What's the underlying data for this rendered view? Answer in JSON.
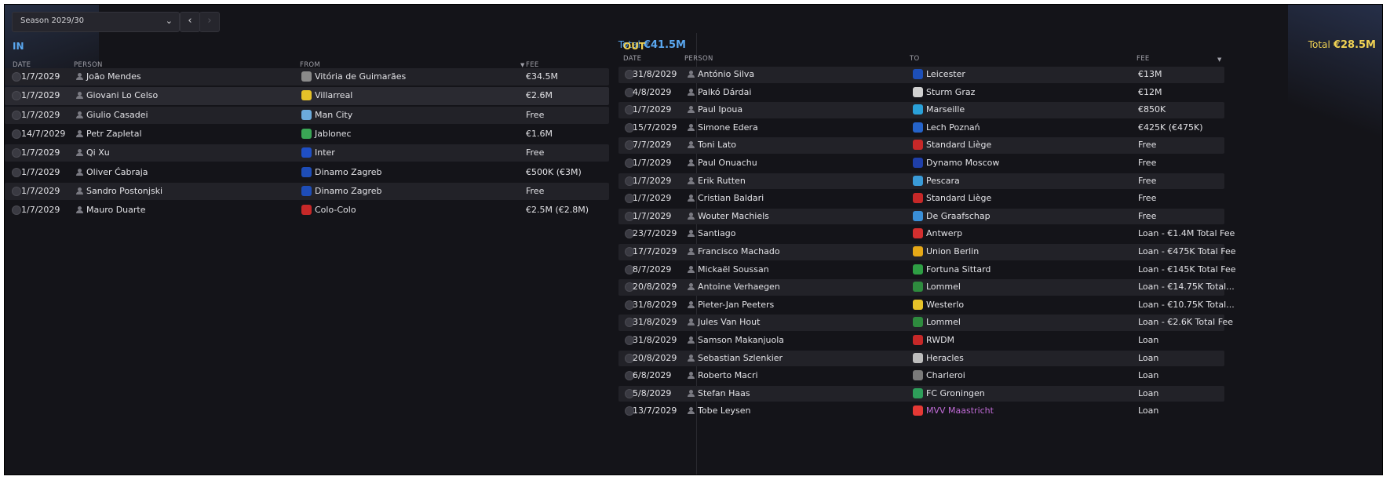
{
  "season": {
    "label": "Season 2029/30"
  },
  "in": {
    "title": "IN",
    "total_label": "Total",
    "total_value": "€41.5M",
    "columns": [
      "DATE",
      "PERSON",
      "FROM",
      "FEE"
    ],
    "rows": [
      {
        "date": "1/7/2029",
        "person": "João Mendes",
        "club": "Vitória de Guimarães",
        "fee": "€34.5M",
        "badge": "#8a8a8a"
      },
      {
        "date": "1/7/2029",
        "person": "Giovani Lo Celso",
        "club": "Villarreal",
        "fee": "€2.6M",
        "badge": "#e6c229"
      },
      {
        "date": "1/7/2029",
        "person": "Giulio Casadei",
        "club": "Man City",
        "fee": "Free",
        "badge": "#6cabdd"
      },
      {
        "date": "14/7/2029",
        "person": "Petr Zapletal",
        "club": "Jablonec",
        "fee": "€1.6M",
        "badge": "#3aa655"
      },
      {
        "date": "1/7/2029",
        "person": "Qi Xu",
        "club": "Inter",
        "fee": "Free",
        "badge": "#1f4fc4"
      },
      {
        "date": "1/7/2029",
        "person": "Oliver Ćabraja",
        "club": "Dinamo Zagreb",
        "fee": "€500K (€3M)",
        "badge": "#1e4db7"
      },
      {
        "date": "1/7/2029",
        "person": "Sandro Postonjski",
        "club": "Dinamo Zagreb",
        "fee": "Free",
        "badge": "#1e4db7"
      },
      {
        "date": "1/7/2029",
        "person": "Mauro Duarte",
        "club": "Colo-Colo",
        "fee": "€2.5M (€2.8M)",
        "badge": "#c62828"
      }
    ]
  },
  "out": {
    "title": "OUT",
    "total_label": "Total",
    "total_value": "€28.5M",
    "columns": [
      "DATE",
      "PERSON",
      "TO",
      "FEE"
    ],
    "rows": [
      {
        "date": "31/8/2029",
        "person": "António Silva",
        "club": "Leicester",
        "fee": "€13M",
        "badge": "#1d4fb8"
      },
      {
        "date": "4/8/2029",
        "person": "Palkó Dárdai",
        "club": "Sturm Graz",
        "fee": "€12M",
        "badge": "#d0d0d0"
      },
      {
        "date": "1/7/2029",
        "person": "Paul Ipoua",
        "club": "Marseille",
        "fee": "€850K",
        "badge": "#2aa0d8"
      },
      {
        "date": "15/7/2029",
        "person": "Simone Edera",
        "club": "Lech Poznań",
        "fee": "€425K (€475K)",
        "badge": "#2563c9"
      },
      {
        "date": "7/7/2029",
        "person": "Toni Lato",
        "club": "Standard Liège",
        "fee": "Free",
        "badge": "#c62828"
      },
      {
        "date": "1/7/2029",
        "person": "Paul Onuachu",
        "club": "Dynamo Moscow",
        "fee": "Free",
        "badge": "#1f3fa8"
      },
      {
        "date": "1/7/2029",
        "person": "Erik Rutten",
        "club": "Pescara",
        "fee": "Free",
        "badge": "#3a9bd8"
      },
      {
        "date": "1/7/2029",
        "person": "Cristian Baldari",
        "club": "Standard Liège",
        "fee": "Free",
        "badge": "#c62828"
      },
      {
        "date": "1/7/2029",
        "person": "Wouter Machiels",
        "club": "De Graafschap",
        "fee": "Free",
        "badge": "#3a8fd8"
      },
      {
        "date": "23/7/2029",
        "person": "Santiago",
        "club": "Antwerp",
        "fee": "Loan - €1.4M Total Fee",
        "badge": "#d32f2f"
      },
      {
        "date": "17/7/2029",
        "person": "Francisco Machado",
        "club": "Union Berlin",
        "fee": "Loan - €475K Total Fee",
        "badge": "#e6a817"
      },
      {
        "date": "8/7/2029",
        "person": "Mickaël Soussan",
        "club": "Fortuna Sittard",
        "fee": "Loan - €145K Total Fee",
        "badge": "#2e9e44"
      },
      {
        "date": "20/8/2029",
        "person": "Antoine Verhaegen",
        "club": "Lommel",
        "fee": "Loan - €14.75K Total...",
        "badge": "#2e8b3e"
      },
      {
        "date": "31/8/2029",
        "person": "Pieter-Jan Peeters",
        "club": "Westerlo",
        "fee": "Loan - €10.75K Total...",
        "badge": "#e6c229"
      },
      {
        "date": "31/8/2029",
        "person": "Jules Van Hout",
        "club": "Lommel",
        "fee": "Loan - €2.6K Total Fee",
        "badge": "#2e8b3e"
      },
      {
        "date": "31/8/2029",
        "person": "Samson Makanjuola",
        "club": "RWDM",
        "fee": "Loan",
        "badge": "#c62828"
      },
      {
        "date": "20/8/2029",
        "person": "Sebastian Szlenkier",
        "club": "Heracles",
        "fee": "Loan",
        "badge": "#bdbdbd"
      },
      {
        "date": "6/8/2029",
        "person": "Roberto Macri",
        "club": "Charleroi",
        "fee": "Loan",
        "badge": "#7a7a7a"
      },
      {
        "date": "5/8/2029",
        "person": "Stefan Haas",
        "club": "FC Groningen",
        "fee": "Loan",
        "badge": "#2e9e5a"
      },
      {
        "date": "13/7/2029",
        "person": "Tobe Leysen",
        "club": "MVV Maastricht",
        "fee": "Loan",
        "badge": "#e53935",
        "club_color": "#c06bd6"
      }
    ]
  },
  "colors": {
    "in_accent": "#5aa7ef",
    "out_accent": "#f0d254"
  }
}
